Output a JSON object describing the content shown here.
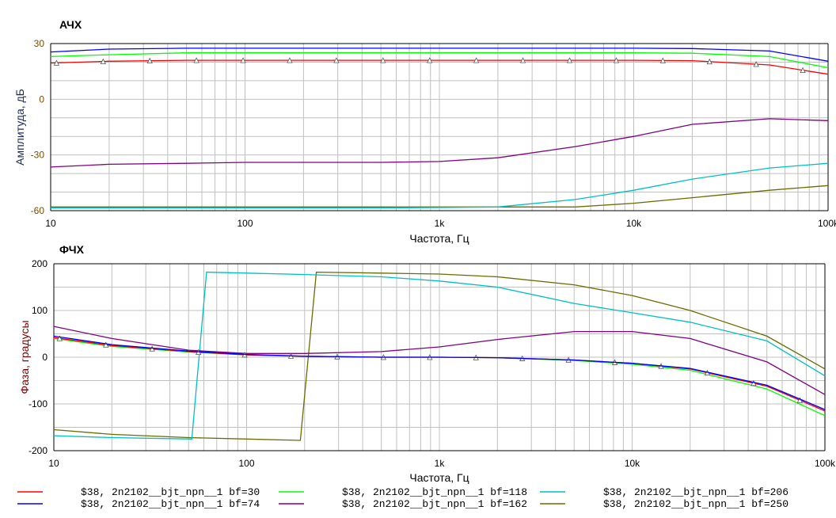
{
  "chart_data": [
    {
      "type": "line",
      "title": "АЧХ",
      "xlabel": "Частота, Гц",
      "ylabel": "Амплитуда, дБ",
      "xscale": "log",
      "xlim": [
        10,
        100000
      ],
      "ylim": [
        -60,
        30
      ],
      "xticks": [
        {
          "v": 10,
          "l": "10"
        },
        {
          "v": 100,
          "l": "100"
        },
        {
          "v": 1000,
          "l": "1k"
        },
        {
          "v": 10000,
          "l": "10k"
        },
        {
          "v": 100000,
          "l": "100k"
        }
      ],
      "yticks": [
        30,
        0,
        -30,
        -60
      ],
      "grid_step": 10,
      "x": [
        10,
        20,
        50,
        100,
        200,
        500,
        1000,
        2000,
        5000,
        10000,
        20000,
        50000,
        100000
      ],
      "series": [
        {
          "name": "bf=30",
          "color": "#ff0000",
          "markers": true,
          "values": [
            19.5,
            20.5,
            21,
            21,
            21,
            21,
            21,
            21,
            21,
            21,
            20.8,
            18.5,
            13.5
          ]
        },
        {
          "name": "bf=74",
          "color": "#0000ff",
          "values": [
            25.5,
            27,
            27.5,
            27.5,
            27.5,
            27.5,
            27.5,
            27.5,
            27.5,
            27.5,
            27.3,
            26,
            20.5
          ]
        },
        {
          "name": "bf=118",
          "color": "#00ff00",
          "values": [
            23,
            24,
            25,
            25,
            25,
            25,
            25,
            25,
            25,
            25,
            24.8,
            23,
            17
          ]
        },
        {
          "name": "bf=162",
          "color": "#800080",
          "values": [
            -36.5,
            -35,
            -34.5,
            -34,
            -34,
            -34,
            -33.5,
            -31.5,
            -25.5,
            -20,
            -13.5,
            -10.5,
            -11.5
          ]
        },
        {
          "name": "bf=206",
          "color": "#00c0c0",
          "values": [
            -58.5,
            -58.5,
            -58.5,
            -58.5,
            -58.5,
            -58.5,
            -58.3,
            -58,
            -54,
            -49,
            -43,
            -37,
            -34.5
          ]
        },
        {
          "name": "bf=250",
          "color": "#6b6b00",
          "values": [
            -58,
            -58,
            -58,
            -58,
            -58,
            -58,
            -58,
            -58,
            -58,
            -56,
            -53,
            -49,
            -46.5
          ]
        }
      ]
    },
    {
      "type": "line",
      "title": "ФЧХ",
      "xlabel": "Частота, Гц",
      "ylabel": "Фаза, градусы",
      "xscale": "log",
      "xlim": [
        10,
        100000
      ],
      "ylim": [
        -200,
        200
      ],
      "xticks": [
        {
          "v": 10,
          "l": "10"
        },
        {
          "v": 100,
          "l": "100"
        },
        {
          "v": 1000,
          "l": "1k"
        },
        {
          "v": 10000,
          "l": "10k"
        },
        {
          "v": 100000,
          "l": "100k"
        }
      ],
      "yticks": [
        200,
        100,
        0,
        -100,
        -200
      ],
      "grid_step": 50,
      "series": [
        {
          "name": "bf=30",
          "color": "#ff0000",
          "markers": true,
          "x": [
            10,
            20,
            50,
            100,
            200,
            500,
            1000,
            2000,
            5000,
            10000,
            20000,
            50000,
            100000
          ],
          "values": [
            42,
            25,
            12,
            5,
            2,
            0,
            0,
            -1,
            -6,
            -13,
            -25,
            -62,
            -115
          ]
        },
        {
          "name": "bf=74",
          "color": "#0000ff",
          "x": [
            10,
            20,
            50,
            100,
            200,
            500,
            1000,
            2000,
            5000,
            10000,
            20000,
            50000,
            100000
          ],
          "values": [
            45,
            27,
            13,
            6,
            2,
            0,
            0,
            -1,
            -6,
            -13,
            -24,
            -60,
            -112
          ]
        },
        {
          "name": "bf=118",
          "color": "#00ff00",
          "x": [
            10,
            20,
            50,
            100,
            200,
            500,
            1000,
            2000,
            5000,
            10000,
            20000,
            50000,
            100000
          ],
          "values": [
            40,
            23,
            11,
            5,
            2,
            0,
            0,
            -1,
            -7,
            -15,
            -28,
            -68,
            -125
          ]
        },
        {
          "name": "bf=162",
          "color": "#800080",
          "x": [
            10,
            20,
            50,
            100,
            200,
            500,
            1000,
            2000,
            5000,
            10000,
            20000,
            50000,
            100000
          ],
          "values": [
            66,
            40,
            15,
            8,
            8,
            12,
            22,
            38,
            55,
            55,
            40,
            -10,
            -80
          ]
        },
        {
          "name": "bf=206",
          "color": "#00c0c0",
          "x": [
            10,
            20,
            52,
            62,
            100,
            200,
            500,
            1000,
            2000,
            5000,
            10000,
            20000,
            50000,
            100000
          ],
          "values": [
            -168,
            -172,
            -175,
            182,
            180,
            177,
            172,
            163,
            150,
            115,
            95,
            75,
            35,
            -40
          ]
        },
        {
          "name": "bf=250",
          "color": "#6b6b00",
          "x": [
            10,
            20,
            50,
            100,
            190,
            230,
            500,
            1000,
            2000,
            5000,
            10000,
            20000,
            50000,
            100000
          ],
          "values": [
            -155,
            -165,
            -172,
            -175,
            -178,
            182,
            180,
            178,
            172,
            155,
            132,
            100,
            45,
            -25
          ]
        }
      ]
    }
  ],
  "legend": [
    {
      "label": "$38, 2n2102__bjt_npn__1 bf=30",
      "color": "#ff0000"
    },
    {
      "label": "$38, 2n2102__bjt_npn__1 bf=118",
      "color": "#00ff00"
    },
    {
      "label": "$38, 2n2102__bjt_npn__1 bf=206",
      "color": "#00c0c0"
    },
    {
      "label": "$38, 2n2102__bjt_npn__1 bf=74",
      "color": "#0000ff"
    },
    {
      "label": "$38, 2n2102__bjt_npn__1 bf=162",
      "color": "#800080"
    },
    {
      "label": "$38, 2n2102__bjt_npn__1 bf=250",
      "color": "#6b6b00"
    }
  ]
}
